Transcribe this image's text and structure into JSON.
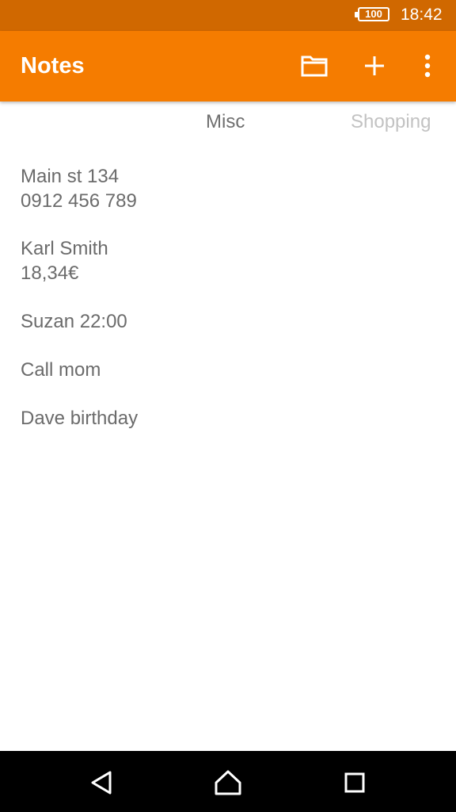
{
  "status_bar": {
    "battery_level": "100",
    "time": "18:42"
  },
  "app_bar": {
    "title": "Notes",
    "icons": [
      "folder-icon",
      "add-icon",
      "more-vert-icon"
    ]
  },
  "tabs": [
    {
      "label": "Misc",
      "active": true
    },
    {
      "label": "Shopping",
      "active": false
    }
  ],
  "notes": [
    {
      "lines": [
        "Main st 134",
        "0912 456 789"
      ]
    },
    {
      "lines": [
        "Karl Smith",
        "18,34€"
      ]
    },
    {
      "lines": [
        "Suzan 22:00"
      ]
    },
    {
      "lines": [
        "Call mom"
      ]
    },
    {
      "lines": [
        "Dave birthday"
      ]
    }
  ],
  "nav_bar": {
    "icons": [
      "back-icon",
      "home-icon",
      "recents-icon"
    ]
  },
  "colors": {
    "status_bar": "#d06800",
    "app_bar": "#f57c00",
    "text_primary": "#6b6b6b",
    "tab_inactive": "#c2c2c2"
  }
}
